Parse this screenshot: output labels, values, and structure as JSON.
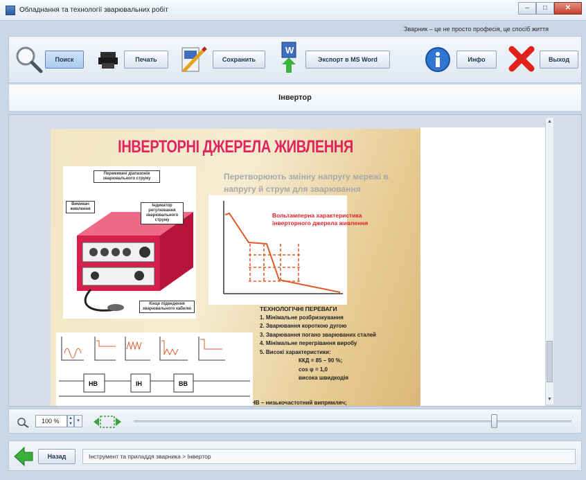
{
  "window": {
    "title": "Обладнання та технології зварювальних робіт",
    "minimize_label": "–",
    "maximize_label": "□",
    "close_label": "✕"
  },
  "slogan": "Зварник – це не просто професія, це спосіб життя",
  "toolbar": {
    "search_label": "Поиск",
    "print_label": "Печать",
    "save_label": "Сохранить",
    "export_label": "Экспорт в MS Word",
    "info_label": "Инфо",
    "exit_label": "Выход",
    "icons": [
      "magnifier-icon",
      "printer-icon",
      "save-icon",
      "word-export-icon",
      "info-icon",
      "exit-icon"
    ]
  },
  "page_heading": "Інвертор",
  "slide": {
    "title": "ІНВЕРТОРНІ ДЖЕРЕЛА ЖИВЛЕННЯ",
    "subtitle": "Перетворюють змінну напругу мережі в напругу й струм для зварювання",
    "graph_caption": "Вольтамперна характеристика інверторного джерела живлення",
    "callouts": {
      "regulator": "Перемикачі діапазонів зварювального струму",
      "power": "Вимикач живлення",
      "indicator": "Індикатор регулювання зварювального струму",
      "cable": "Кінце підведення зварювального кабелю"
    },
    "tech_heading": "ТЕХНОЛОГІЧНІ ПЕРЕВАГИ",
    "tech_items": [
      "1. Мінімальне розбризкування",
      "2. Зварювання короткою дугою",
      "3. Зварювання погано зварюваних сталей",
      "4. Мінімальне перегрівання виробу",
      "5. Високі характеристики:"
    ],
    "tech_specs": [
      "ККД = 85 – 90 %;",
      "cos φ = 1,0",
      "висока швидкодія"
    ],
    "tech_footer": "НВ – низькочастотний випрямляч;",
    "circuit_blocks": [
      "НВ",
      "ІН",
      "ВВ"
    ]
  },
  "zoom": {
    "value": "100 %",
    "up": "▲",
    "down": "▼",
    "drop": "▾"
  },
  "nav": {
    "back_label": "Назад",
    "breadcrumb": "Інструмент та приладдя зварника > Інвертор"
  }
}
